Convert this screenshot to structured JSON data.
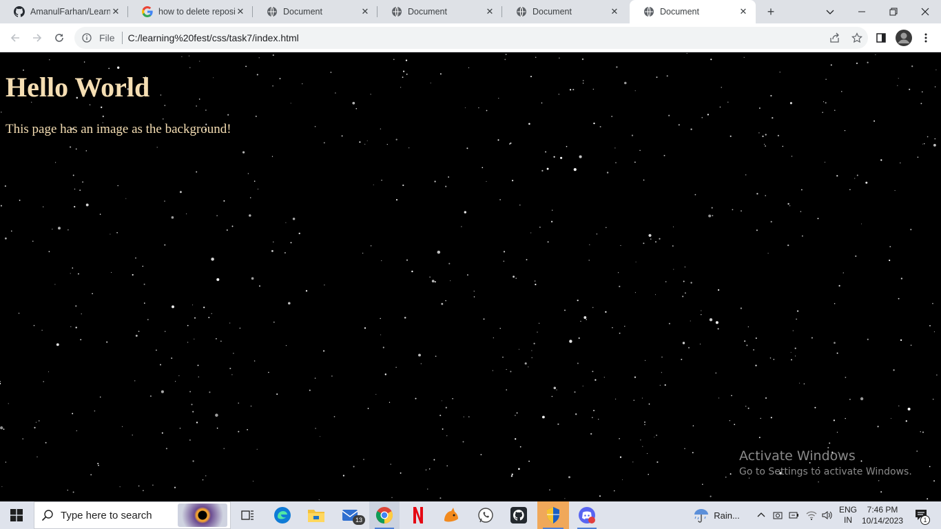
{
  "browser": {
    "tabs": [
      {
        "title": "AmanulFarhan/Learni",
        "icon": "github-icon"
      },
      {
        "title": "how to delete reposit",
        "icon": "google-icon"
      },
      {
        "title": "Document",
        "icon": "globe-icon"
      },
      {
        "title": "Document",
        "icon": "globe-icon"
      },
      {
        "title": "Document",
        "icon": "globe-icon"
      },
      {
        "title": "Document",
        "icon": "globe-icon"
      }
    ],
    "active_tab": 5,
    "close_glyph": "✕",
    "new_tab_glyph": "+",
    "scheme_label": "File",
    "url": "C:/learning%20fest/css/task7/index.html"
  },
  "page": {
    "heading": "Hello World",
    "paragraph": "This page has an image as the background!",
    "text_color": "#f5deb3",
    "background": "starfield"
  },
  "watermark": {
    "line1": "Activate Windows",
    "line2": "Go to Settings to activate Windows."
  },
  "taskbar": {
    "search_placeholder": "Type here to search",
    "mail_badge": "13",
    "weather": "Rain...",
    "language_top": "ENG",
    "language_bottom": "IN",
    "time": "7:46 PM",
    "date": "10/14/2023",
    "notification_count": "1"
  }
}
